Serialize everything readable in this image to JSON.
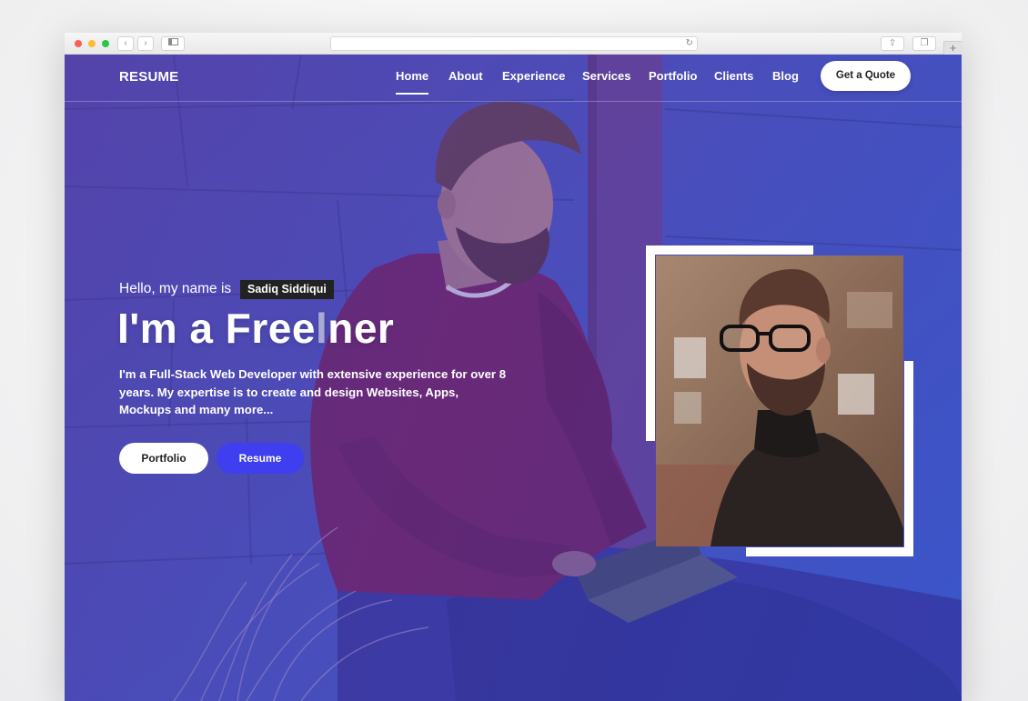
{
  "nav": {
    "brand": "RESUME",
    "items": [
      {
        "label": "Home"
      },
      {
        "label": "About"
      },
      {
        "label": "Experience"
      },
      {
        "label": "Services"
      },
      {
        "label": "Portfolio"
      },
      {
        "label": "Clients"
      },
      {
        "label": "Blog"
      }
    ],
    "cta": "Get a Quote"
  },
  "hero": {
    "greeting": "Hello, my name is",
    "name": "Sadiq Siddiqui",
    "headline_prefix": "I'm a",
    "headline_typed": "Free",
    "headline_caret": "l",
    "headline_rest": "ner",
    "description": "I'm a Full-Stack Web Developer with extensive experience for over 8 years. My expertise is to create and design Websites, Apps, Mockups and many more...",
    "button_primary": "Portfolio",
    "button_secondary": "Resume"
  },
  "colors": {
    "accent": "#3f3ff0",
    "overlay": "#4a3fb0",
    "sweater": "#7a1f5e"
  },
  "icons": [
    "back-icon",
    "forward-icon",
    "sidebar-icon",
    "reload-icon",
    "share-icon",
    "tabs-icon",
    "new-tab-icon"
  ]
}
